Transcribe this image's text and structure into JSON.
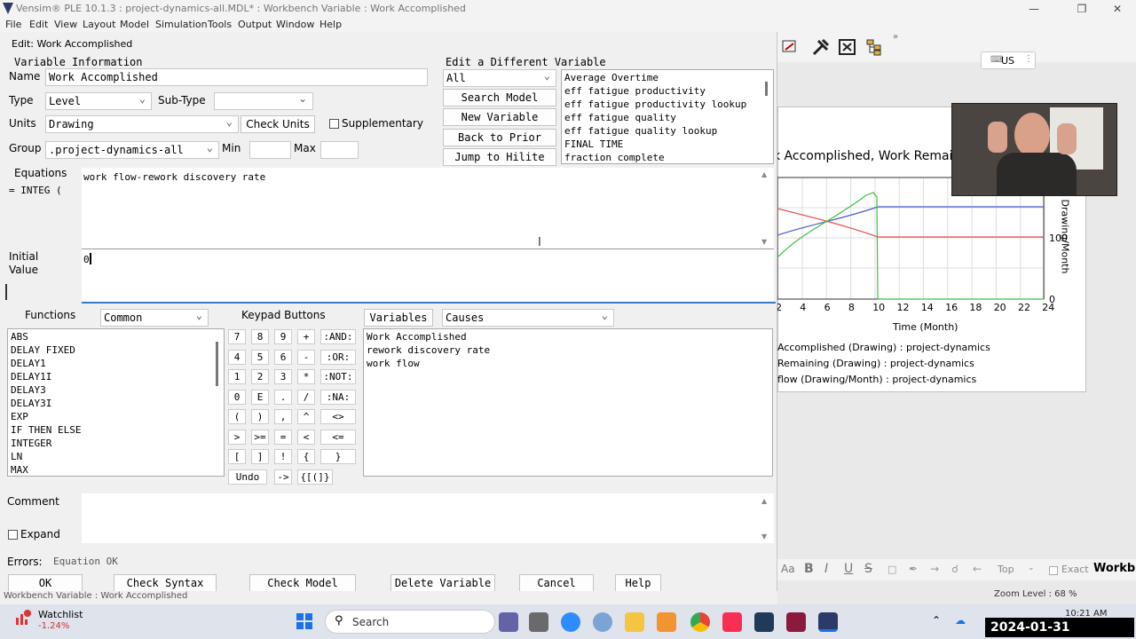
{
  "window": {
    "title": "Vensim® PLE 10.1.3 : project-dynamics-all.MDL* : Workbench Variable : Work Accomplished",
    "menu": [
      "File",
      "Edit",
      "View",
      "Layout",
      "Model",
      "Simulation",
      "Tools",
      "Output",
      "Window",
      "Help"
    ],
    "status": "Workbench Variable : Work Accomplished"
  },
  "dialog": {
    "title": "Edit: Work Accomplished",
    "var_info_heading": "Variable Information",
    "name_label": "Name",
    "name_value": "Work Accomplished",
    "type_label": "Type",
    "type_value": "Level",
    "subtype_label": "Sub-Type",
    "subtype_value": "",
    "units_label": "Units",
    "units_value": "Drawing",
    "check_units": "Check Units",
    "supplementary": "Supplementary",
    "group_label": "Group",
    "group_value": ".project-dynamics-all",
    "min_label": "Min",
    "max_label": "Max",
    "edit_diff_heading": "Edit a Different Variable",
    "filter_value": "All",
    "search_model": "Search Model",
    "new_variable": "New Variable",
    "back_prior": "Back to Prior Edit",
    "jump_hilite": "Jump to Hilite",
    "var_list": [
      "Average Overtime",
      "eff fatigue productivity",
      "eff fatigue productivity lookup",
      "eff fatigue quality",
      "eff fatigue quality lookup",
      "FINAL TIME",
      "fraction complete"
    ],
    "equations_label": "Equations",
    "integ_label": "= INTEG (",
    "equation_text": "work flow-rework discovery rate",
    "initial_label_1": "Initial",
    "initial_label_2": "Value",
    "initial_value": "0",
    "functions_label": "Functions",
    "functions_filter": "Common",
    "functions": [
      "ABS",
      "DELAY FIXED",
      "DELAY1",
      "DELAY1I",
      "DELAY3",
      "DELAY3I",
      "EXP",
      "IF THEN ELSE",
      "INTEGER",
      "LN",
      "MAX"
    ],
    "keypad_label": "Keypad Buttons",
    "keypad": [
      [
        "7",
        "8",
        "9",
        "+",
        ":AND:"
      ],
      [
        "4",
        "5",
        "6",
        "-",
        ":OR:"
      ],
      [
        "1",
        "2",
        "3",
        "*",
        ":NOT:"
      ],
      [
        "0",
        "E",
        ".",
        "/",
        ":NA:"
      ],
      [
        "(",
        ")",
        ",",
        "^",
        "<>"
      ],
      [
        ">",
        ">=",
        "=",
        "<",
        "<="
      ],
      [
        "[",
        "]",
        "!",
        "{",
        "}"
      ],
      [
        "Undo",
        "->",
        "{[(]}"
      ]
    ],
    "variables_btn": "Variables",
    "causes_value": "Causes",
    "causes": [
      "Work Accomplished",
      "rework discovery rate",
      "work flow"
    ],
    "comment_label": "Comment",
    "expand_label": "Expand",
    "errors_label": "Errors:",
    "errors_value": "Equation OK",
    "buttons": {
      "ok": "OK",
      "check_syntax": "Check Syntax",
      "check_model": "Check Model",
      "delete_variable": "Delete Variable",
      "cancel": "Cancel",
      "help": "Help"
    }
  },
  "background_app": {
    "graph_title": "k Accomplished, Work Remaining",
    "x_ticks": [
      "2",
      "4",
      "6",
      "8",
      "10",
      "12",
      "14",
      "16",
      "18",
      "20",
      "22",
      "24"
    ],
    "x_label": "Time (Month)",
    "y_right_label": "Drawing/Month",
    "y_right_ticks": [
      "100",
      "0"
    ],
    "legend": [
      "Accomplished (Drawing) : project-dynamics",
      "Remaining (Drawing) : project-dynamics",
      "flow (Drawing/Month) : project-dynamics"
    ],
    "locale": "US",
    "format_items": [
      "Aa",
      "B",
      "I",
      "U",
      "S",
      "Top",
      "Exact",
      "Workb"
    ],
    "zoom": "Zoom Level : 68 %"
  },
  "taskbar": {
    "watchlist": "Watchlist",
    "watchlist_change": "-1.24%",
    "search": "Search",
    "time": "10:21 AM",
    "date_overlay": "2024-01-31  10:21:22"
  },
  "colors": {
    "accent": "#3a78c6",
    "series_blue": "#4a5fcf",
    "series_red": "#e05050",
    "series_green": "#3fbf3f"
  }
}
